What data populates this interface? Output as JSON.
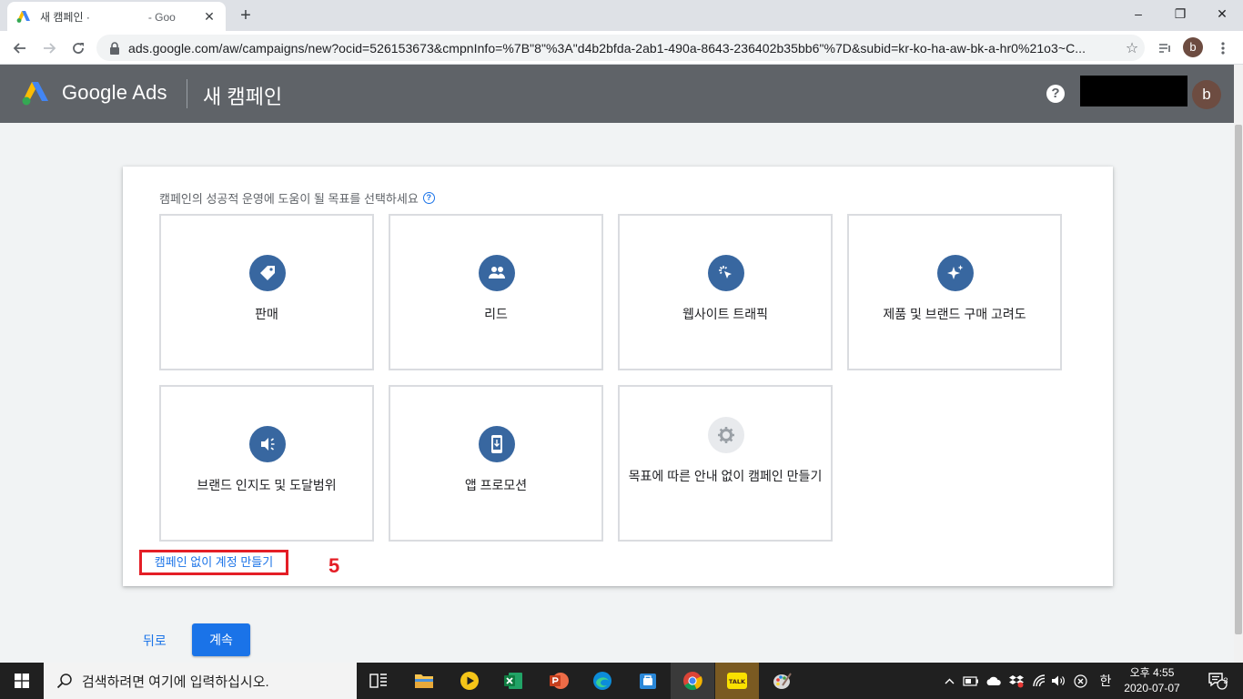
{
  "browser": {
    "tab": {
      "title": "새 캠페인 ·",
      "title_tail": "- Goo",
      "close": "✕"
    },
    "new_tab": "+",
    "window_controls": {
      "minimize": "–",
      "restore": "❐",
      "close": "✕"
    },
    "url": "ads.google.com/aw/campaigns/new?ocid=526153673&cmpnInfo=%7B\"8\"%3A\"d4b2bfda-2ab1-490a-8643-236402b35bb6\"%7D&subid=kr-ko-ha-aw-bk-a-hr0%21o3~C...",
    "profile_initial": "b"
  },
  "header": {
    "brand": "Google Ads",
    "page_title": "새 캠페인",
    "help": "?",
    "avatar_initial": "b"
  },
  "main": {
    "prompt": "캠페인의 성공적 운영에 도움이 될 목표를 선택하세요",
    "goals": [
      {
        "label": "판매",
        "icon": "tag-icon"
      },
      {
        "label": "리드",
        "icon": "people-icon"
      },
      {
        "label": "웹사이트 트래픽",
        "icon": "cursor-click-icon"
      },
      {
        "label": "제품 및 브랜드 구매 고려도",
        "icon": "sparkle-icon"
      },
      {
        "label": "브랜드 인지도 및 도달범위",
        "icon": "megaphone-icon"
      },
      {
        "label": "앱 프로모션",
        "icon": "phone-download-icon"
      },
      {
        "label": "목표에 따른 안내 없이 캠페인 만들기",
        "icon": "gear-icon"
      }
    ],
    "no_campaign_link": "캠페인 없이 계정 만들기",
    "annotation": "5",
    "back_label": "뒤로",
    "continue_label": "계속"
  },
  "taskbar": {
    "search_placeholder": "검색하려면 여기에 입력하십시오.",
    "ime": "한",
    "time": "오후 4:55",
    "date": "2020-07-07",
    "notification_count": "3"
  },
  "colors": {
    "goal_icon_bg": "#3867a0",
    "primary_blue": "#1a73e8",
    "annotation_red": "#e41e26",
    "header_gray": "#5f6368"
  }
}
